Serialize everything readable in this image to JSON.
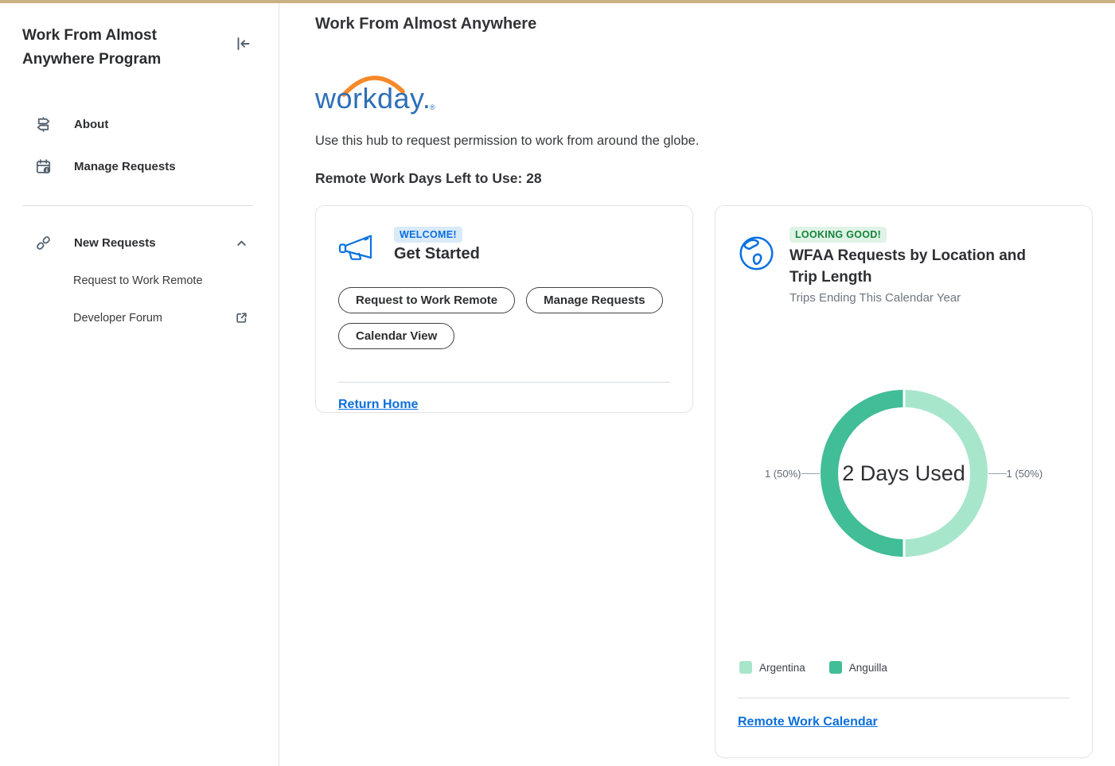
{
  "app": {
    "accent_color": "#C9B183"
  },
  "sidebar": {
    "title": "Work From Almost Anywhere Program",
    "items": [
      {
        "label": "About",
        "icon": "signpost-icon"
      },
      {
        "label": "Manage Requests",
        "icon": "calendar-info-icon"
      }
    ],
    "new_requests": {
      "label": "New Requests",
      "icon": "chain-link-icon",
      "expanded": true,
      "children": [
        {
          "label": "Request to Work Remote"
        },
        {
          "label": "Developer Forum",
          "external": true
        }
      ]
    }
  },
  "main": {
    "title": "Work From Almost Anywhere",
    "logo": {
      "text": "workday.",
      "mark": "®",
      "text_color": "#2D6FB7",
      "arc_color": "#F6892B"
    },
    "description": "Use this hub to request permission to work from around the globe.",
    "days_left": "Remote Work Days Left to Use: 28"
  },
  "get_started_card": {
    "badge": "WELCOME!",
    "badge_bg": "#D9EAF9",
    "badge_text_color": "#0B6FDB",
    "title": "Get Started",
    "buttons": [
      "Request to Work Remote",
      "Manage Requests",
      "Calendar View"
    ],
    "link": "Return Home"
  },
  "wfaa_card": {
    "badge": "LOOKING GOOD!",
    "badge_bg": "#DFF3E6",
    "badge_text_color": "#15833B",
    "title": "WFAA Requests by Location and Trip Length",
    "subtitle": "Trips Ending This Calendar Year",
    "link": "Remote Work Calendar"
  },
  "chart_data": {
    "type": "pie",
    "variant": "donut",
    "title": "WFAA Requests by Location and Trip Length",
    "subtitle": "Trips Ending This Calendar Year",
    "center_label": "2 Days Used",
    "series": [
      {
        "name": "Argentina",
        "value": 1,
        "percent": 50,
        "callout": "1 (50%)",
        "color": "#A8E6CC"
      },
      {
        "name": "Anguilla",
        "value": 1,
        "percent": 50,
        "callout": "1 (50%)",
        "color": "#41BD97"
      }
    ],
    "legend_position": "bottom"
  }
}
